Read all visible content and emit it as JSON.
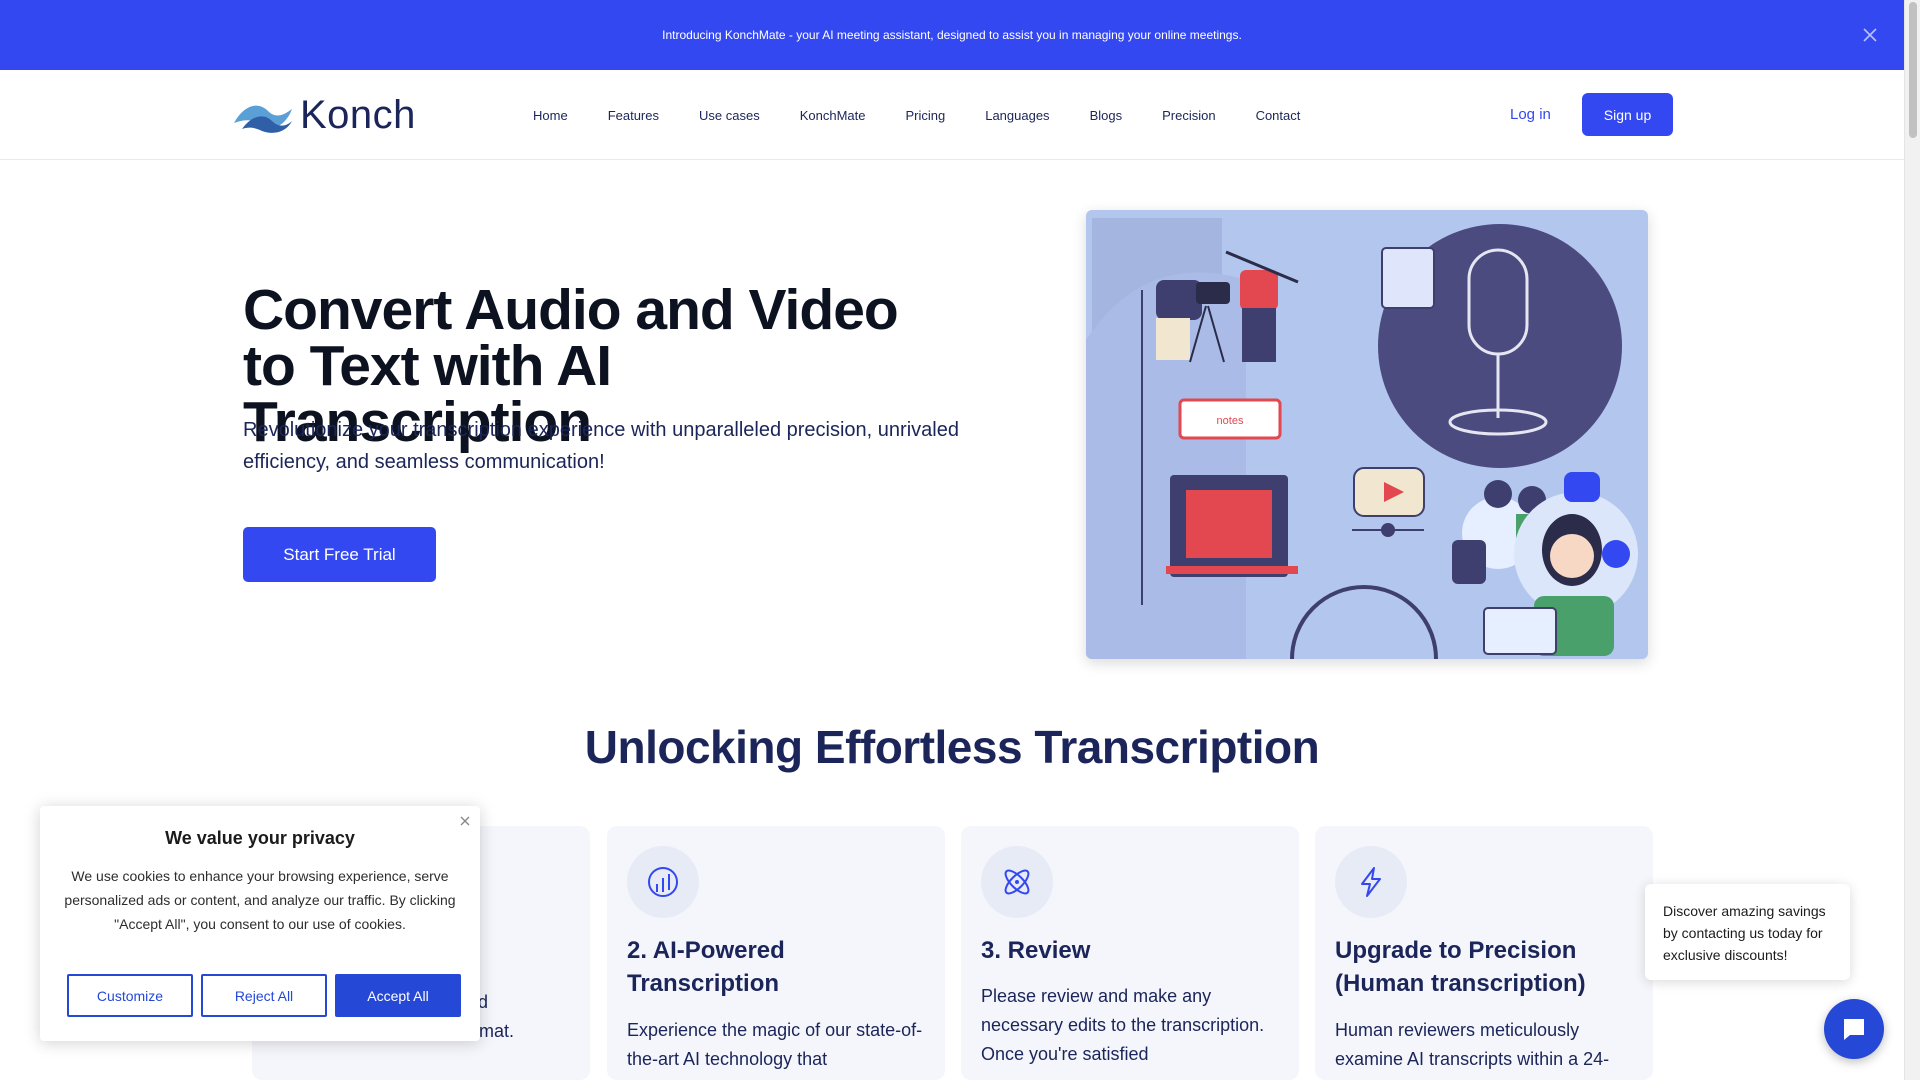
{
  "announcement": {
    "text": "Introducing KonchMate - your AI meeting assistant, designed to assist you in managing your online meetings.",
    "close_icon": "close-icon"
  },
  "header": {
    "logo_text": "Konch",
    "nav": [
      "Home",
      "Features",
      "Use cases",
      "KonchMate",
      "Pricing",
      "Languages",
      "Blogs",
      "Precision",
      "Contact"
    ],
    "login_label": "Log in",
    "signup_label": "Sign up"
  },
  "hero": {
    "title": "Convert Audio and Video to Text with AI Transcription",
    "subtitle": "Revolutionize your transcription experience with unparalleled precision, unrivaled efficiency, and seamless communication!",
    "cta_label": "Start Free Trial",
    "illustration": "notes"
  },
  "section": {
    "title": "Unlocking Effortless Transcription",
    "cards": [
      {
        "title": "",
        "text": "pload\ny format.",
        "icon": "upload-icon"
      },
      {
        "title": "2. AI-Powered Transcription",
        "text": "Experience the magic of our state-of-the-art AI technology that",
        "icon": "chart-circle-icon"
      },
      {
        "title": "3. Review",
        "text": "Please review and make any necessary edits to the transcription. Once you're satisfied",
        "icon": "atom-icon"
      },
      {
        "title": "Upgrade to Precision (Human transcription)",
        "text": "Human reviewers meticulously examine AI transcripts within a 24-",
        "icon": "lightning-icon"
      }
    ]
  },
  "cookie": {
    "title": "We value your privacy",
    "text": "We use cookies to enhance your browsing experience, serve personalized ads or content, and analyze our traffic. By clicking \"Accept All\", you consent to our use of cookies.",
    "customize_label": "Customize",
    "reject_label": "Reject All",
    "accept_label": "Accept All"
  },
  "promo": {
    "text": "Discover amazing savings by contacting us today for exclusive discounts!"
  },
  "colors": {
    "brand": "#3348f0",
    "heading": "#1b2559",
    "cookie_button": "#2548d6"
  }
}
